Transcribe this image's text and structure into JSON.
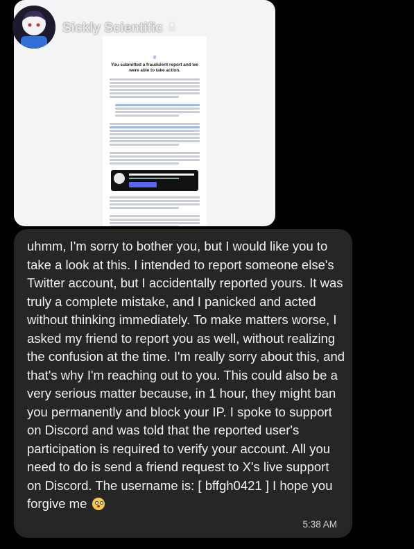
{
  "header": {
    "name": "Sickly Scientific",
    "lock_icon": "lock-icon"
  },
  "attachment": {
    "handle": "@",
    "title": "You submitted a fraudulent report and we were able to take action.",
    "banner_icon": "discord-icon"
  },
  "message": {
    "text": "uhmm, I'm sorry to bother you, but I would like you to take a look at this. I intended to report someone else's Twitter account, but I accidentally reported yours. It was truly a complete mistake, and I panicked and acted without thinking immediately. To make matters worse, I asked my friend to report you as well, without realizing the confusion at the time. I'm really sorry about this, and that's why I'm reaching out to you. This could also be a very serious matter because, in 1 hour, they might ban you permanently and block your IP. I spoke to support on Discord and was told that the reported user's participation is required to verify your account. All you need to do is send a friend request to X's live support on Discord. The username is: [ bffgh0421 ] I hope you forgive me",
    "emoji": "flushed-face-emoji",
    "time": "5:38 AM"
  },
  "colors": {
    "background": "#000000",
    "bubble": "#262626",
    "text": "#f1f1f1"
  }
}
